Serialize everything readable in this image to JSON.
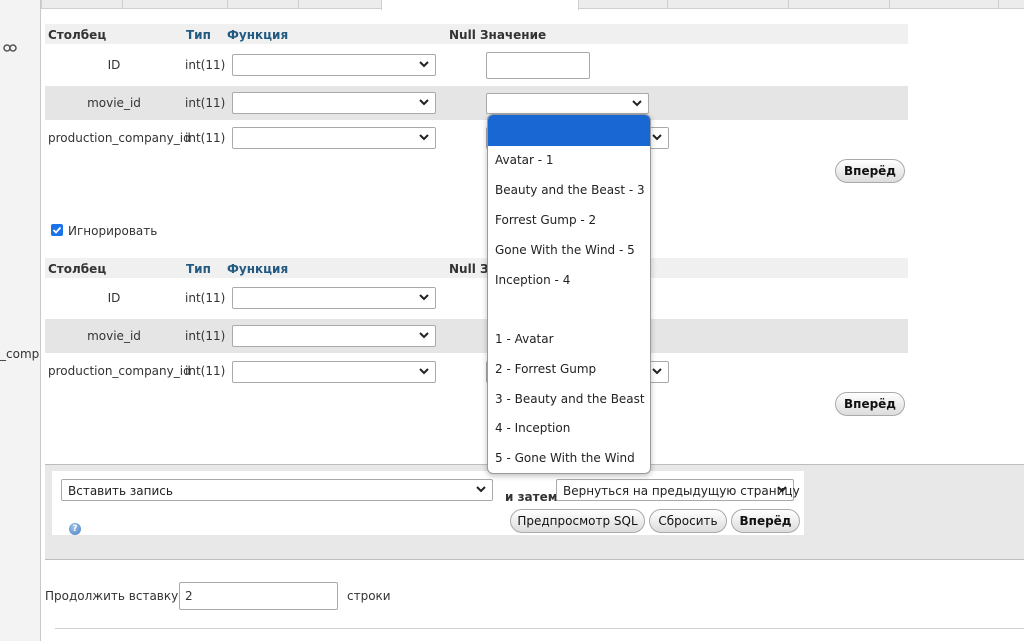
{
  "sidebar": {
    "cut_text": "_compa"
  },
  "table1": {
    "headers": {
      "column": "Столбец",
      "type": "Тип",
      "function": "Функция",
      "null": "Null",
      "value": "Значение"
    },
    "rows": [
      {
        "name": "ID",
        "type": "int(11)"
      },
      {
        "name": "movie_id",
        "type": "int(11)"
      },
      {
        "name": "production_company_id",
        "type": "int(11)"
      }
    ],
    "go_label": "Вперёд"
  },
  "ignore": {
    "label": "Игнорировать",
    "checked": true
  },
  "table2": {
    "headers": {
      "column": "Столбец",
      "type": "Тип",
      "function": "Функция",
      "null": "Null",
      "value": "З"
    },
    "rows": [
      {
        "name": "ID",
        "type": "int(11)"
      },
      {
        "name": "movie_id",
        "type": "int(11)"
      },
      {
        "name": "production_company_id",
        "type": "int(11)"
      }
    ],
    "go_label": "Вперёд"
  },
  "dropdown": {
    "options": [
      "",
      "Avatar - 1",
      "Beauty and the Beast - 3",
      "Forrest Gump - 2",
      "Gone With the Wind - 5",
      "Inception - 4",
      "",
      "1 - Avatar",
      "2 - Forrest Gump",
      "3 - Beauty and the Beast",
      "4 - Inception",
      "5 - Gone With the Wind"
    ],
    "selected_index": 0
  },
  "actions": {
    "insert_select": "Вставить запись",
    "and_then": "и затем",
    "after_select": "Вернуться на предыдущую страницу",
    "preview_sql": "Предпросмотр SQL",
    "reset": "Сбросить",
    "go": "Вперёд"
  },
  "continue": {
    "label": "Продолжить вставку с",
    "value": "2",
    "suffix": "строки"
  },
  "colors": {
    "accent": "#1967d2",
    "header_link": "#235a81",
    "row_alt": "#e5e5e5"
  }
}
